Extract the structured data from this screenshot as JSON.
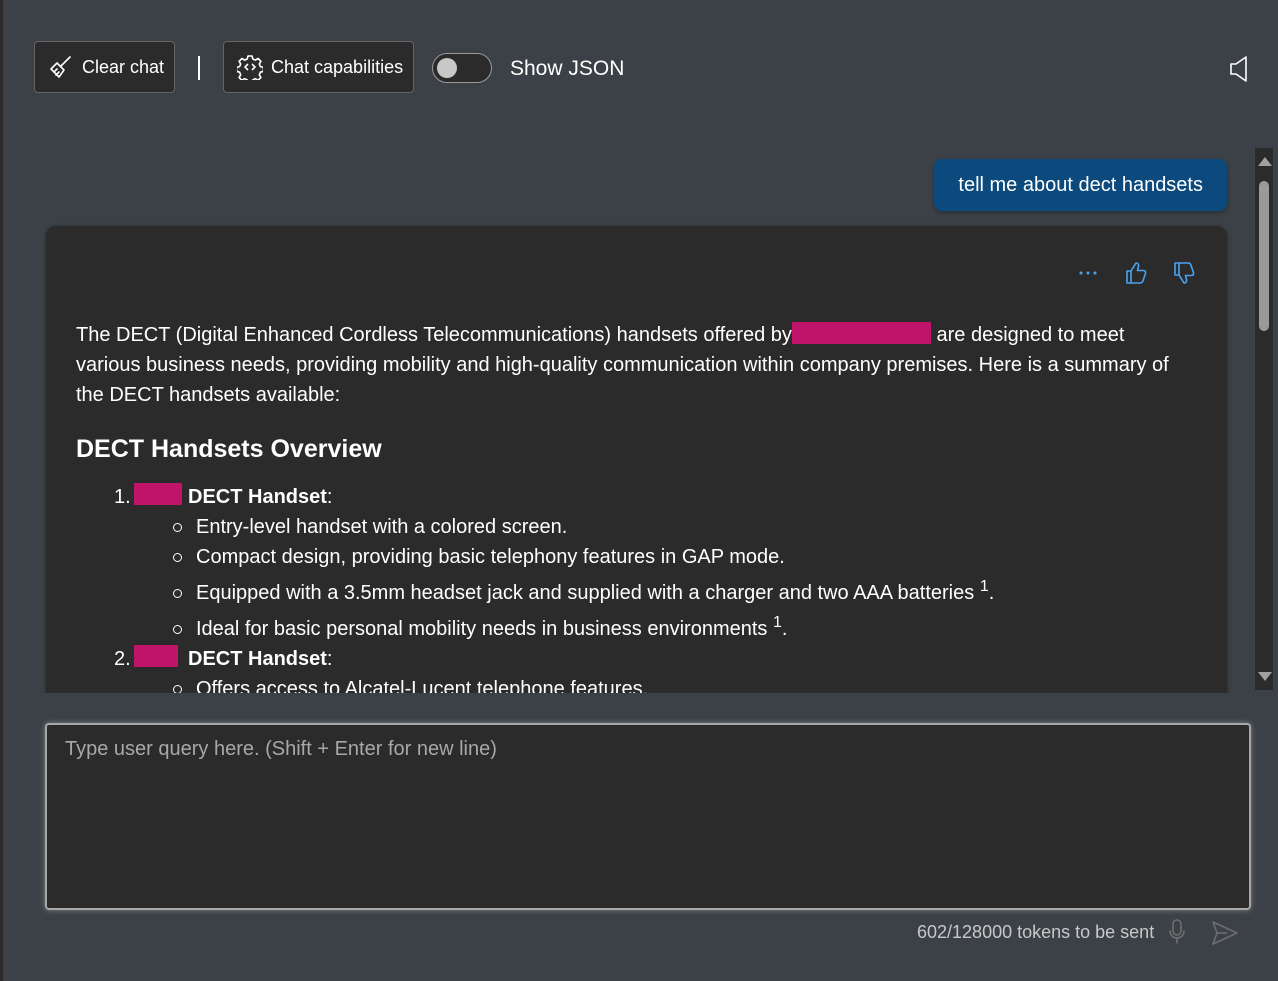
{
  "toolbar": {
    "clear_chat_label": "Clear chat",
    "capabilities_label": "Chat capabilities",
    "show_json_label": "Show JSON",
    "show_json_enabled": false
  },
  "conversation": {
    "user_message": "tell me about dect handsets",
    "assistant": {
      "intro_before": "The DECT (Digital Enhanced Cordless Telecommunications) handsets offered by",
      "intro_after": " are designed to meet various business needs, providing mobility and high-quality communication within company premises. Here is a summary of the DECT handsets available:",
      "heading": "DECT Handsets Overview",
      "items": [
        {
          "number": "1.",
          "name": "DECT Handset",
          "colon": ":",
          "bullets": [
            {
              "text": "Entry-level handset with a colored screen.",
              "ref": "",
              "tail": ""
            },
            {
              "text": "Compact design, providing basic telephony features in GAP mode.",
              "ref": "",
              "tail": ""
            },
            {
              "text": "Equipped with a 3.5mm headset jack and supplied with a charger and two AAA batteries ",
              "ref": "1",
              "tail": "."
            },
            {
              "text": "Ideal for basic personal mobility needs in business environments ",
              "ref": "1",
              "tail": "."
            }
          ]
        },
        {
          "number": "2.",
          "name": "DECT Handset",
          "colon": ":",
          "bullets": [
            {
              "text": "Offers access to Alcatel-Lucent telephone features.",
              "ref": "",
              "tail": ""
            }
          ]
        }
      ]
    }
  },
  "input": {
    "placeholder": "Type user query here. (Shift + Enter for new line)",
    "value": ""
  },
  "footer": {
    "token_count": "602/128000 tokens to be sent"
  },
  "colors": {
    "user_bubble": "#0c4a7e",
    "redaction": "#c0136a",
    "accent_icon": "#4aa3f0"
  },
  "icons": [
    "broom-icon",
    "gear-icon",
    "speaker-icon",
    "more-icon",
    "thumbs-up-icon",
    "thumbs-down-icon",
    "mic-icon",
    "send-icon"
  ]
}
